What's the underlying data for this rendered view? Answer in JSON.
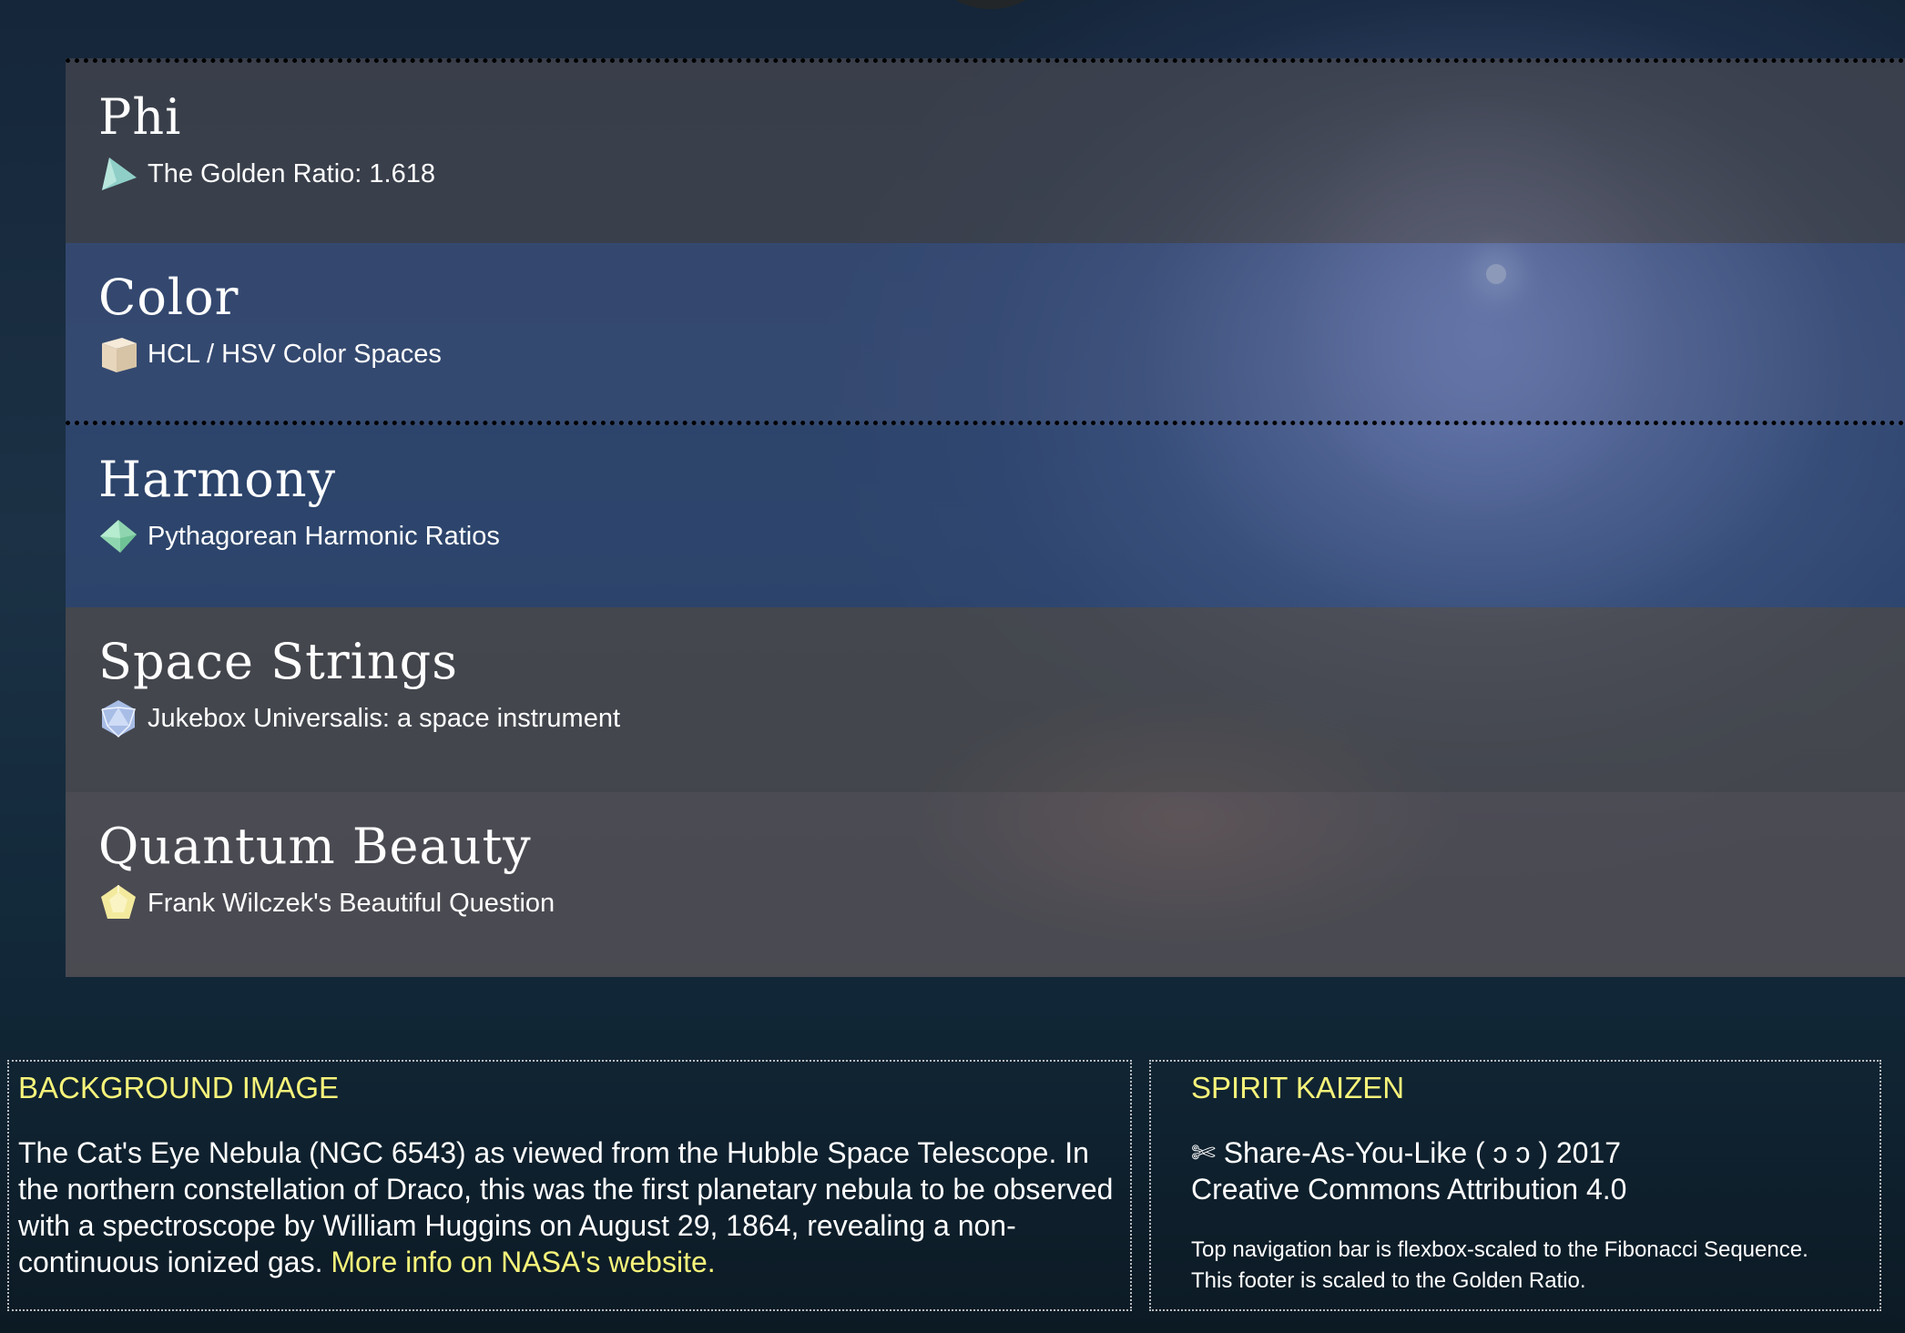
{
  "menu": {
    "items": [
      {
        "title": "Phi",
        "subtitle": "The Golden Ratio: 1.618",
        "icon": "tetrahedron-icon"
      },
      {
        "title": "Color",
        "subtitle": "HCL / HSV Color Spaces",
        "icon": "cube-icon"
      },
      {
        "title": "Harmony",
        "subtitle": "Pythagorean Harmonic Ratios",
        "icon": "octahedron-icon"
      },
      {
        "title": "Space Strings",
        "subtitle": "Jukebox Universalis: a space instrument",
        "icon": "icosahedron-icon"
      },
      {
        "title": "Quantum Beauty",
        "subtitle": "Frank Wilczek's Beautiful Question",
        "icon": "dodecahedron-icon"
      }
    ]
  },
  "footer": {
    "background": {
      "heading": "BACKGROUND IMAGE",
      "text": "The Cat's Eye Nebula (NGC 6543) as viewed from the Hubble Space Telescope. In the northern constellation of Draco, this was the first planetary nebula to be observed with a spectroscope by William Huggins on August 29, 1864, revealing a non-continuous ionized gas.",
      "link": "More info on NASA's website."
    },
    "kaizen": {
      "heading": "SPIRIT KAIZEN",
      "share": "✄ Share-As-You-Like ( ↄ ↄ ) 2017",
      "license_link": "Creative Commons Attribution 4.0",
      "note1": "Top navigation bar is flexbox-scaled to the Fibonacci Sequence.",
      "note2": "This footer is scaled to the Golden Ratio."
    }
  },
  "colors": {
    "accent": "#f6f37a",
    "text": "#ffffff"
  }
}
